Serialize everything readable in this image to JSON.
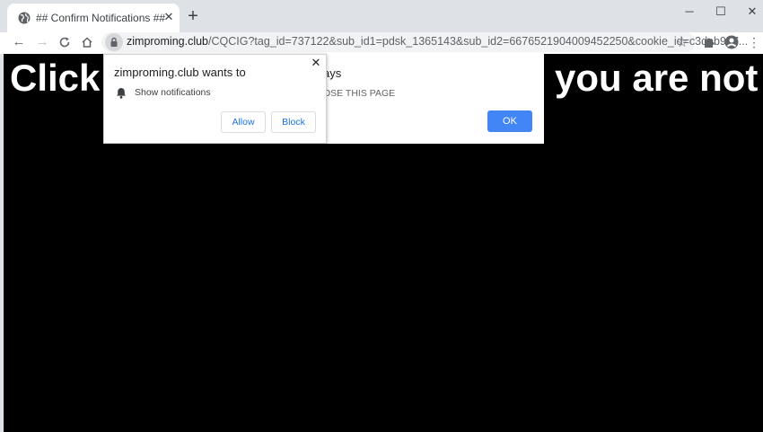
{
  "tab": {
    "title": "## Confirm Notifications ##",
    "close": "✕",
    "new_tab": "+"
  },
  "window": {
    "minimize": "─",
    "maximize": "☐",
    "close": "✕"
  },
  "toolbar": {
    "back": "←",
    "forward": "→",
    "reload": "C",
    "home": "⌂",
    "url_host": "zimproming.club",
    "url_path": "/CQCIG?tag_id=737122&sub_id1=pdsk_1365143&sub_id2=6676521904009452250&cookie_id=c3deb957...",
    "star": "☆",
    "menu": "⋮"
  },
  "page": {
    "headline_left": "Click",
    "headline_right": "you are not"
  },
  "alert": {
    "text1": "ays",
    "text2": "OSE THIS PAGE",
    "ok_label": "OK",
    "ok_color": "#4285f4"
  },
  "permission_popup": {
    "title": "zimproming.club wants to",
    "close": "✕",
    "permission_label": "Show notifications",
    "allow_label": "Allow",
    "block_label": "Block",
    "button_text_color": "#1a73e8"
  }
}
